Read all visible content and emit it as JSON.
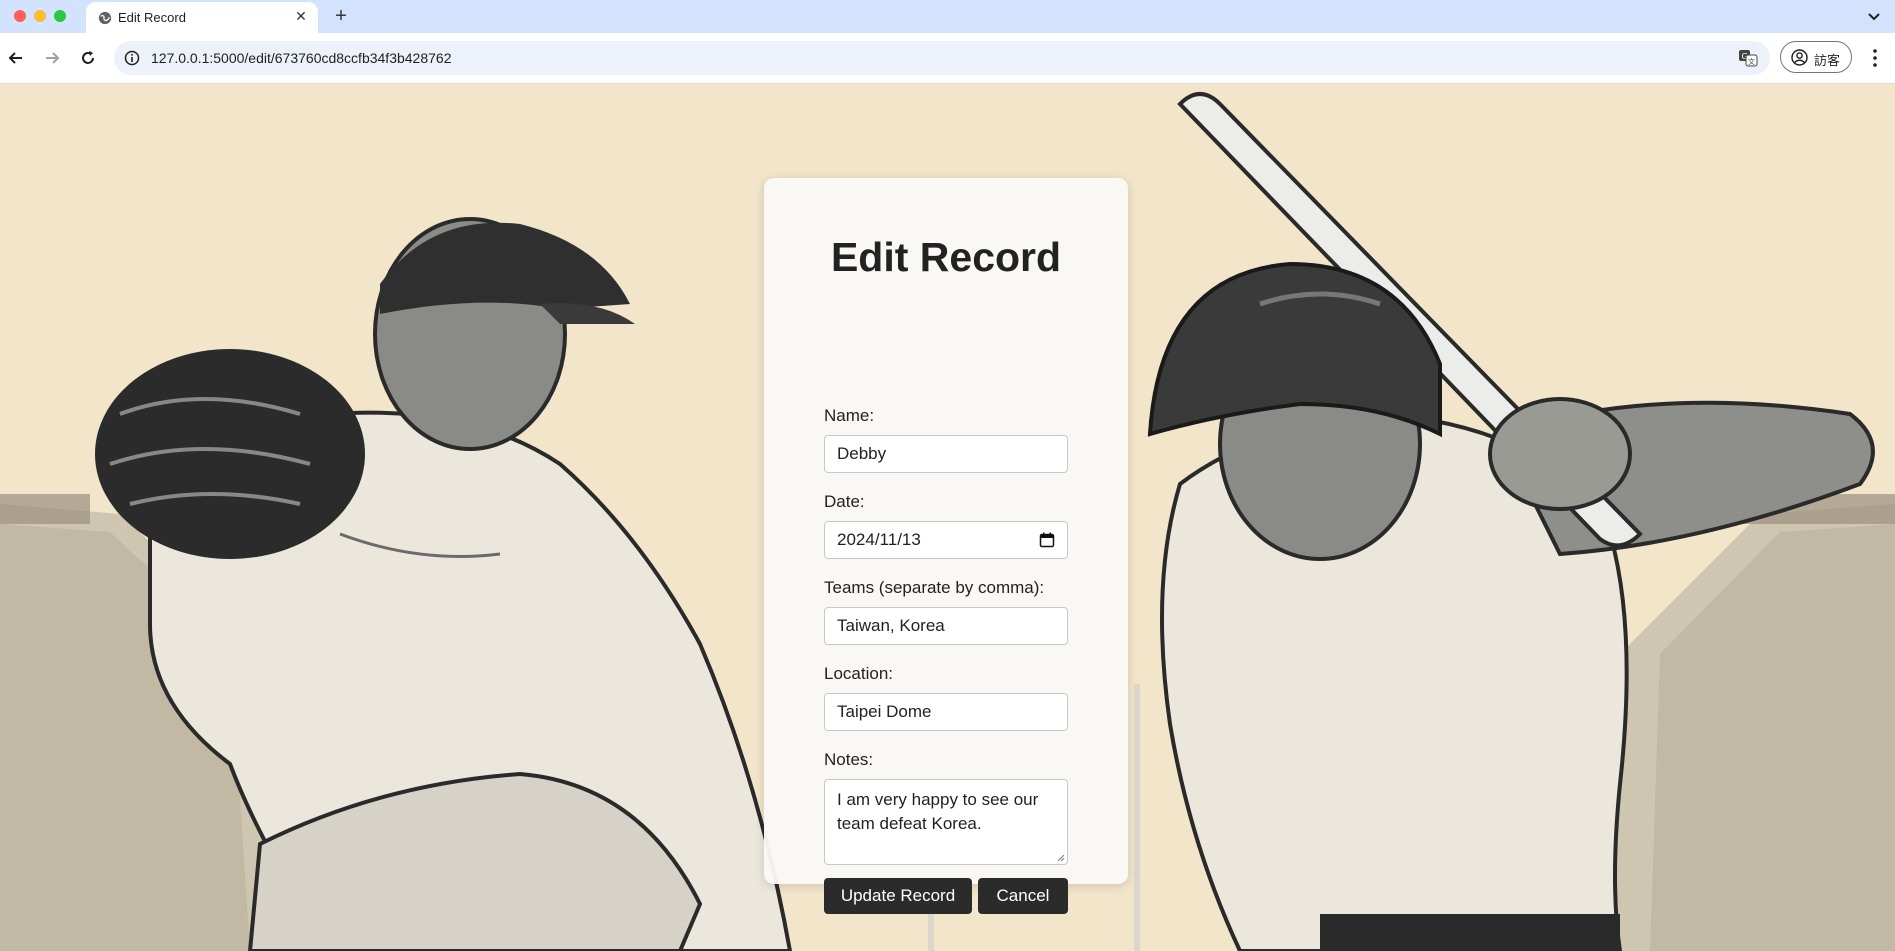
{
  "browser": {
    "tab_title": "Edit Record",
    "new_tab_label": "+",
    "close_tab_label": "✕",
    "url": "127.0.0.1:5000/edit/673760cd8ccfb34f3b428762",
    "profile_label": "訪客"
  },
  "form": {
    "title": "Edit Record",
    "name": {
      "label": "Name:",
      "value": "Debby"
    },
    "date": {
      "label": "Date:",
      "value": "2024/11/13"
    },
    "teams": {
      "label": "Teams (separate by comma):",
      "value": "Taiwan, Korea"
    },
    "location": {
      "label": "Location:",
      "value": "Taipei Dome"
    },
    "notes": {
      "label": "Notes:",
      "value": "I am very happy to see our team defeat Korea."
    },
    "submit_label": "Update Record",
    "cancel_label": "Cancel"
  },
  "colors": {
    "page_background": "#f2e5c9",
    "button": "#2b2b2b",
    "tabstrip": "#d3e3fd"
  }
}
